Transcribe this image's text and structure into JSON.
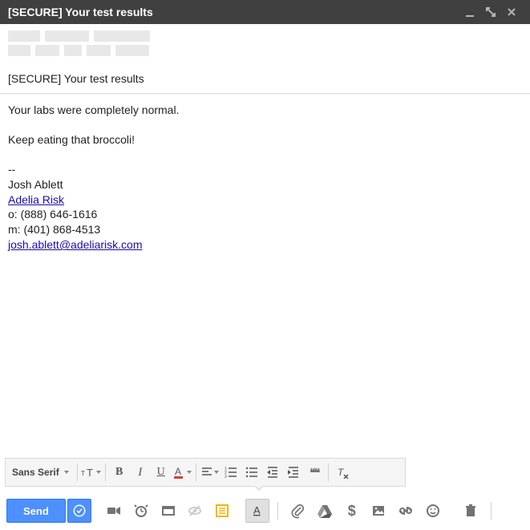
{
  "window": {
    "title": "[SECURE] Your test results"
  },
  "subject": "[SECURE] Your test results",
  "body": {
    "line1": "Your labs were completely normal.",
    "line2": "Keep eating that broccoli!",
    "sig_dashes": "--",
    "sig_name": "Josh Ablett",
    "sig_company": "Adelia Risk",
    "sig_office": "o: (888) 646-1616",
    "sig_mobile": "m: (401) 868-4513",
    "sig_email": "josh.ablett@adeliarisk.com"
  },
  "format_toolbar": {
    "font": "Sans Serif",
    "bold": "B",
    "italic": "I",
    "underline": "U",
    "quotes": "❝❝"
  },
  "actions": {
    "send": "Send"
  }
}
